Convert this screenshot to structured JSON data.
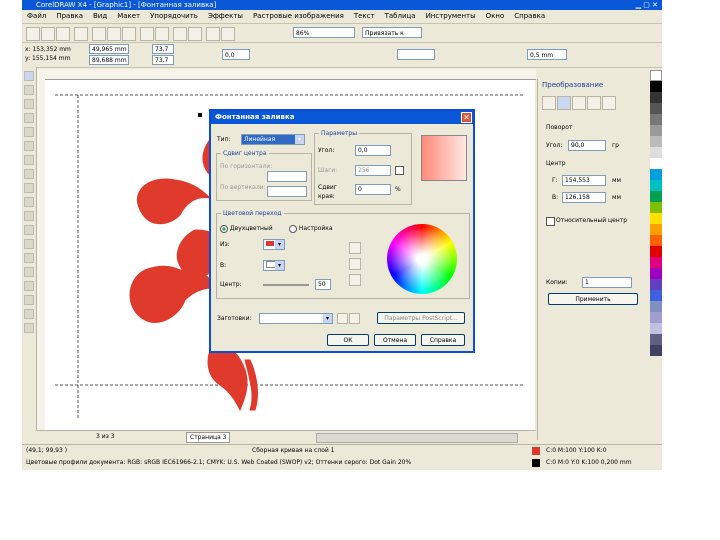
{
  "window": {
    "title": "CorelDRAW X4 - [Graphic1] - [Фонтанная заливка]"
  },
  "menu": [
    "Файл",
    "Правка",
    "Вид",
    "Макет",
    "Упорядочить",
    "Эффекты",
    "Растровые изображения",
    "Текст",
    "Таблица",
    "Инструменты",
    "Окно",
    "Справка"
  ],
  "toolbar": {
    "zoom": "86%",
    "snap": "Привязать к",
    "x": "x: 153,352 mm",
    "y": "y: 155,154 mm",
    "w": "49,965 mm",
    "h": "89,688 mm",
    "sx": "73,7",
    "sy": "73,7",
    "angle": "0,0",
    "outline": "0,5 mm"
  },
  "dialog": {
    "title": "Фонтанная заливка",
    "type_label": "Тип:",
    "type_value": "Линейная",
    "center_group": "Сдвиг центра",
    "center_h": "По горизонтали:",
    "center_v": "По вертикали:",
    "params_group": "Параметры",
    "angle_label": "Угол:",
    "angle_value": "0,0",
    "steps_label": "Шаги:",
    "steps_value": "256",
    "edge_label": "Сдвиг края:",
    "edge_value": "0",
    "edge_unit": "%",
    "blend_group": "Цветовой переход",
    "two_color": "Двухцветный",
    "custom": "Настройка",
    "from_label": "Из:",
    "to_label": "В:",
    "mid_label": "Центр:",
    "mid_value": "50",
    "presets_label": "Заготовки:",
    "postscript": "Параметры PostScript...",
    "ok": "ОК",
    "cancel": "Отмена",
    "help": "Справка"
  },
  "transform": {
    "title": "Преобразование",
    "rotation": "Поворот",
    "angle_label": "Угол:",
    "angle_value": "90,0",
    "angle_unit": "гр",
    "center": "Центр",
    "h_label": "Г:",
    "h_value": "154,553",
    "v_label": "В:",
    "v_value": "126,158",
    "unit": "мм",
    "relative": "Относительный центр",
    "copies_label": "Копии:",
    "copies_value": "1",
    "apply": "Применить"
  },
  "pages": {
    "counter": "3 из 3",
    "tab": "Страница 3"
  },
  "status": {
    "line1": "(49,1; 99,93 ) ",
    "object": "Сборная кривая на слой 1",
    "line2": "Цветовые профили документа: RGB: sRGB IEC61966-2.1; CMYK: U.S. Web Coated (SWOP) v2; Оттенки серого: Dot Gain 20%",
    "fill": "C:0 M:100 Y:100 K:0",
    "outline": "C:0 M:0 Y:0 K:100 0,200 mm"
  },
  "colors": {
    "accent": "#e03a2c",
    "titlebar": "#0a58d8"
  }
}
